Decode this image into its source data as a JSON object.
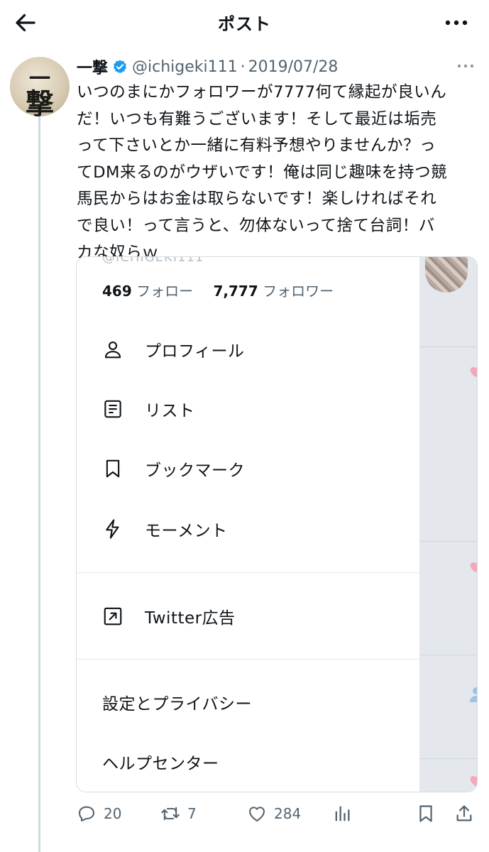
{
  "header": {
    "title": "ポスト",
    "back_icon": "arrow-left-icon",
    "more_icon": "more-horizontal-icon"
  },
  "tweet": {
    "avatar_text_top": "一",
    "avatar_text_bottom": "撃",
    "display_name": "一撃",
    "verified_icon": "verified-badge-icon",
    "handle": "@ichigeki111",
    "separator": "·",
    "date": "2019/07/28",
    "text_lines": [
      "いつのまにかフォロワーが7777何て縁起が良いん",
      "だ！いつも有難うございます！そして最近は垢売",
      "って下さいとか一緒に有料予想やりませんか？っ",
      "てDM来るのがウザいです！俺は同じ趣味を持つ競",
      "馬民からはお金は取らないです！楽しければそれ",
      "で良い！って言うと、勿体ないって捨て台詞！バ",
      "カな奴らｗ"
    ]
  },
  "embedded_screenshot": {
    "following_count": "469",
    "following_label": "フォロー",
    "followers_count": "7,777",
    "followers_label": "フォロワー",
    "menu_items": [
      {
        "label": "プロフィール",
        "icon": "person-icon"
      },
      {
        "label": "リスト",
        "icon": "list-icon"
      },
      {
        "label": "ブックマーク",
        "icon": "bookmark-icon"
      },
      {
        "label": "モーメント",
        "icon": "lightning-icon"
      }
    ],
    "ads_item": {
      "label": "Twitter広告",
      "icon": "external-link-icon"
    },
    "settings_label": "設定とプライバシー",
    "help_label": "ヘルプセンター",
    "side_colors": {
      "background": "#e4e8ec",
      "heart": "#f4a7b9",
      "person": "#9ec3e6"
    }
  },
  "actions": {
    "reply_count": "20",
    "retweet_count": "7",
    "like_count": "284",
    "icons": [
      "reply-icon",
      "retweet-icon",
      "like-icon",
      "views-icon",
      "bookmark-icon",
      "share-icon"
    ]
  },
  "colors": {
    "text": "#0f1419",
    "secondary": "#536471",
    "verified": "#1d9bf0",
    "thread_line": "#cfd9de"
  }
}
